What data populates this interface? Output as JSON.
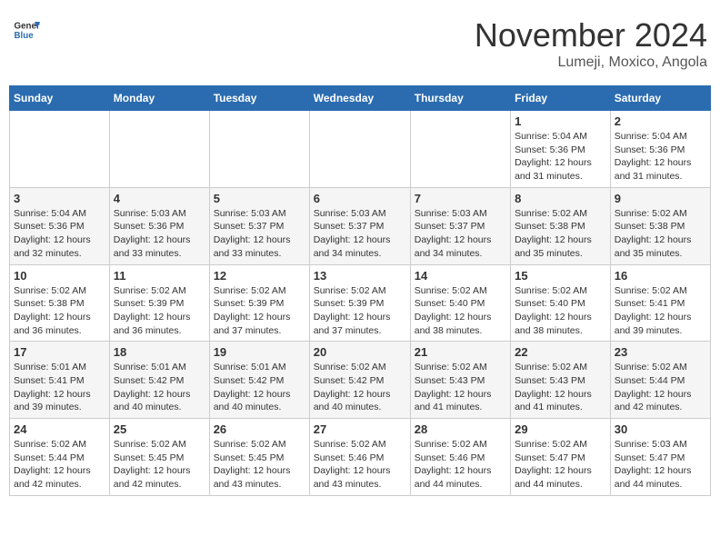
{
  "header": {
    "logo_line1": "General",
    "logo_line2": "Blue",
    "month": "November 2024",
    "location": "Lumeji, Moxico, Angola"
  },
  "weekdays": [
    "Sunday",
    "Monday",
    "Tuesday",
    "Wednesday",
    "Thursday",
    "Friday",
    "Saturday"
  ],
  "weeks": [
    [
      {
        "day": "",
        "info": ""
      },
      {
        "day": "",
        "info": ""
      },
      {
        "day": "",
        "info": ""
      },
      {
        "day": "",
        "info": ""
      },
      {
        "day": "",
        "info": ""
      },
      {
        "day": "1",
        "info": "Sunrise: 5:04 AM\nSunset: 5:36 PM\nDaylight: 12 hours\nand 31 minutes."
      },
      {
        "day": "2",
        "info": "Sunrise: 5:04 AM\nSunset: 5:36 PM\nDaylight: 12 hours\nand 31 minutes."
      }
    ],
    [
      {
        "day": "3",
        "info": "Sunrise: 5:04 AM\nSunset: 5:36 PM\nDaylight: 12 hours\nand 32 minutes."
      },
      {
        "day": "4",
        "info": "Sunrise: 5:03 AM\nSunset: 5:36 PM\nDaylight: 12 hours\nand 33 minutes."
      },
      {
        "day": "5",
        "info": "Sunrise: 5:03 AM\nSunset: 5:37 PM\nDaylight: 12 hours\nand 33 minutes."
      },
      {
        "day": "6",
        "info": "Sunrise: 5:03 AM\nSunset: 5:37 PM\nDaylight: 12 hours\nand 34 minutes."
      },
      {
        "day": "7",
        "info": "Sunrise: 5:03 AM\nSunset: 5:37 PM\nDaylight: 12 hours\nand 34 minutes."
      },
      {
        "day": "8",
        "info": "Sunrise: 5:02 AM\nSunset: 5:38 PM\nDaylight: 12 hours\nand 35 minutes."
      },
      {
        "day": "9",
        "info": "Sunrise: 5:02 AM\nSunset: 5:38 PM\nDaylight: 12 hours\nand 35 minutes."
      }
    ],
    [
      {
        "day": "10",
        "info": "Sunrise: 5:02 AM\nSunset: 5:38 PM\nDaylight: 12 hours\nand 36 minutes."
      },
      {
        "day": "11",
        "info": "Sunrise: 5:02 AM\nSunset: 5:39 PM\nDaylight: 12 hours\nand 36 minutes."
      },
      {
        "day": "12",
        "info": "Sunrise: 5:02 AM\nSunset: 5:39 PM\nDaylight: 12 hours\nand 37 minutes."
      },
      {
        "day": "13",
        "info": "Sunrise: 5:02 AM\nSunset: 5:39 PM\nDaylight: 12 hours\nand 37 minutes."
      },
      {
        "day": "14",
        "info": "Sunrise: 5:02 AM\nSunset: 5:40 PM\nDaylight: 12 hours\nand 38 minutes."
      },
      {
        "day": "15",
        "info": "Sunrise: 5:02 AM\nSunset: 5:40 PM\nDaylight: 12 hours\nand 38 minutes."
      },
      {
        "day": "16",
        "info": "Sunrise: 5:02 AM\nSunset: 5:41 PM\nDaylight: 12 hours\nand 39 minutes."
      }
    ],
    [
      {
        "day": "17",
        "info": "Sunrise: 5:01 AM\nSunset: 5:41 PM\nDaylight: 12 hours\nand 39 minutes."
      },
      {
        "day": "18",
        "info": "Sunrise: 5:01 AM\nSunset: 5:42 PM\nDaylight: 12 hours\nand 40 minutes."
      },
      {
        "day": "19",
        "info": "Sunrise: 5:01 AM\nSunset: 5:42 PM\nDaylight: 12 hours\nand 40 minutes."
      },
      {
        "day": "20",
        "info": "Sunrise: 5:02 AM\nSunset: 5:42 PM\nDaylight: 12 hours\nand 40 minutes."
      },
      {
        "day": "21",
        "info": "Sunrise: 5:02 AM\nSunset: 5:43 PM\nDaylight: 12 hours\nand 41 minutes."
      },
      {
        "day": "22",
        "info": "Sunrise: 5:02 AM\nSunset: 5:43 PM\nDaylight: 12 hours\nand 41 minutes."
      },
      {
        "day": "23",
        "info": "Sunrise: 5:02 AM\nSunset: 5:44 PM\nDaylight: 12 hours\nand 42 minutes."
      }
    ],
    [
      {
        "day": "24",
        "info": "Sunrise: 5:02 AM\nSunset: 5:44 PM\nDaylight: 12 hours\nand 42 minutes."
      },
      {
        "day": "25",
        "info": "Sunrise: 5:02 AM\nSunset: 5:45 PM\nDaylight: 12 hours\nand 42 minutes."
      },
      {
        "day": "26",
        "info": "Sunrise: 5:02 AM\nSunset: 5:45 PM\nDaylight: 12 hours\nand 43 minutes."
      },
      {
        "day": "27",
        "info": "Sunrise: 5:02 AM\nSunset: 5:46 PM\nDaylight: 12 hours\nand 43 minutes."
      },
      {
        "day": "28",
        "info": "Sunrise: 5:02 AM\nSunset: 5:46 PM\nDaylight: 12 hours\nand 44 minutes."
      },
      {
        "day": "29",
        "info": "Sunrise: 5:02 AM\nSunset: 5:47 PM\nDaylight: 12 hours\nand 44 minutes."
      },
      {
        "day": "30",
        "info": "Sunrise: 5:03 AM\nSunset: 5:47 PM\nDaylight: 12 hours\nand 44 minutes."
      }
    ]
  ]
}
